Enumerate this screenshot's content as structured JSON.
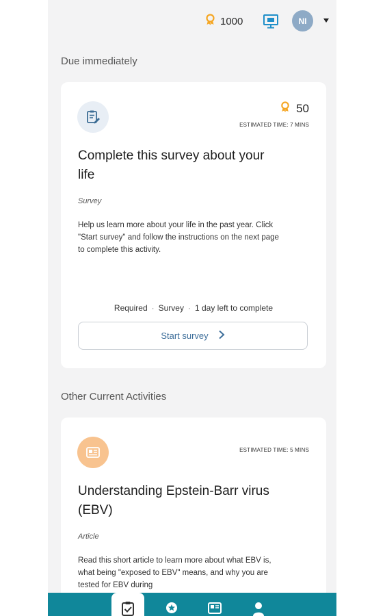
{
  "header": {
    "points": "1000",
    "avatar_initials": "NI"
  },
  "sections": {
    "due": "Due immediately",
    "other": "Other Current Activities"
  },
  "survey_card": {
    "points": "50",
    "estimated_time": "ESTIMATED TIME: 7 MINS",
    "title": "Complete this survey about your life",
    "type": "Survey",
    "description": "Help us learn more about your life in the past year. Click \"Start survey\" and follow the instructions on the next page to complete this activity.",
    "meta": [
      "Required",
      "Survey",
      "1 day left to complete"
    ],
    "button_label": "Start survey"
  },
  "article_card": {
    "estimated_time": "ESTIMATED TIME: 5 MINS",
    "title": "Understanding Epstein-Barr virus (EBV)",
    "type": "Article",
    "description": "Read this short article to learn more about what EBV is, what being \"exposed to EBV\" means, and why you are tested for EBV during"
  },
  "bottom_nav": {
    "items": [
      {
        "icon": "clipboard-check-icon",
        "active": true
      },
      {
        "icon": "star-badge-icon",
        "active": false
      },
      {
        "icon": "news-icon",
        "active": false
      },
      {
        "icon": "profile-icon",
        "active": false
      }
    ]
  },
  "colors": {
    "accent_teal": "#10879a",
    "link_blue": "#3d6e9a",
    "award_orange": "#f5a623",
    "article_icon_bg": "#f8c38f",
    "survey_icon_bg": "#e8eef5"
  }
}
